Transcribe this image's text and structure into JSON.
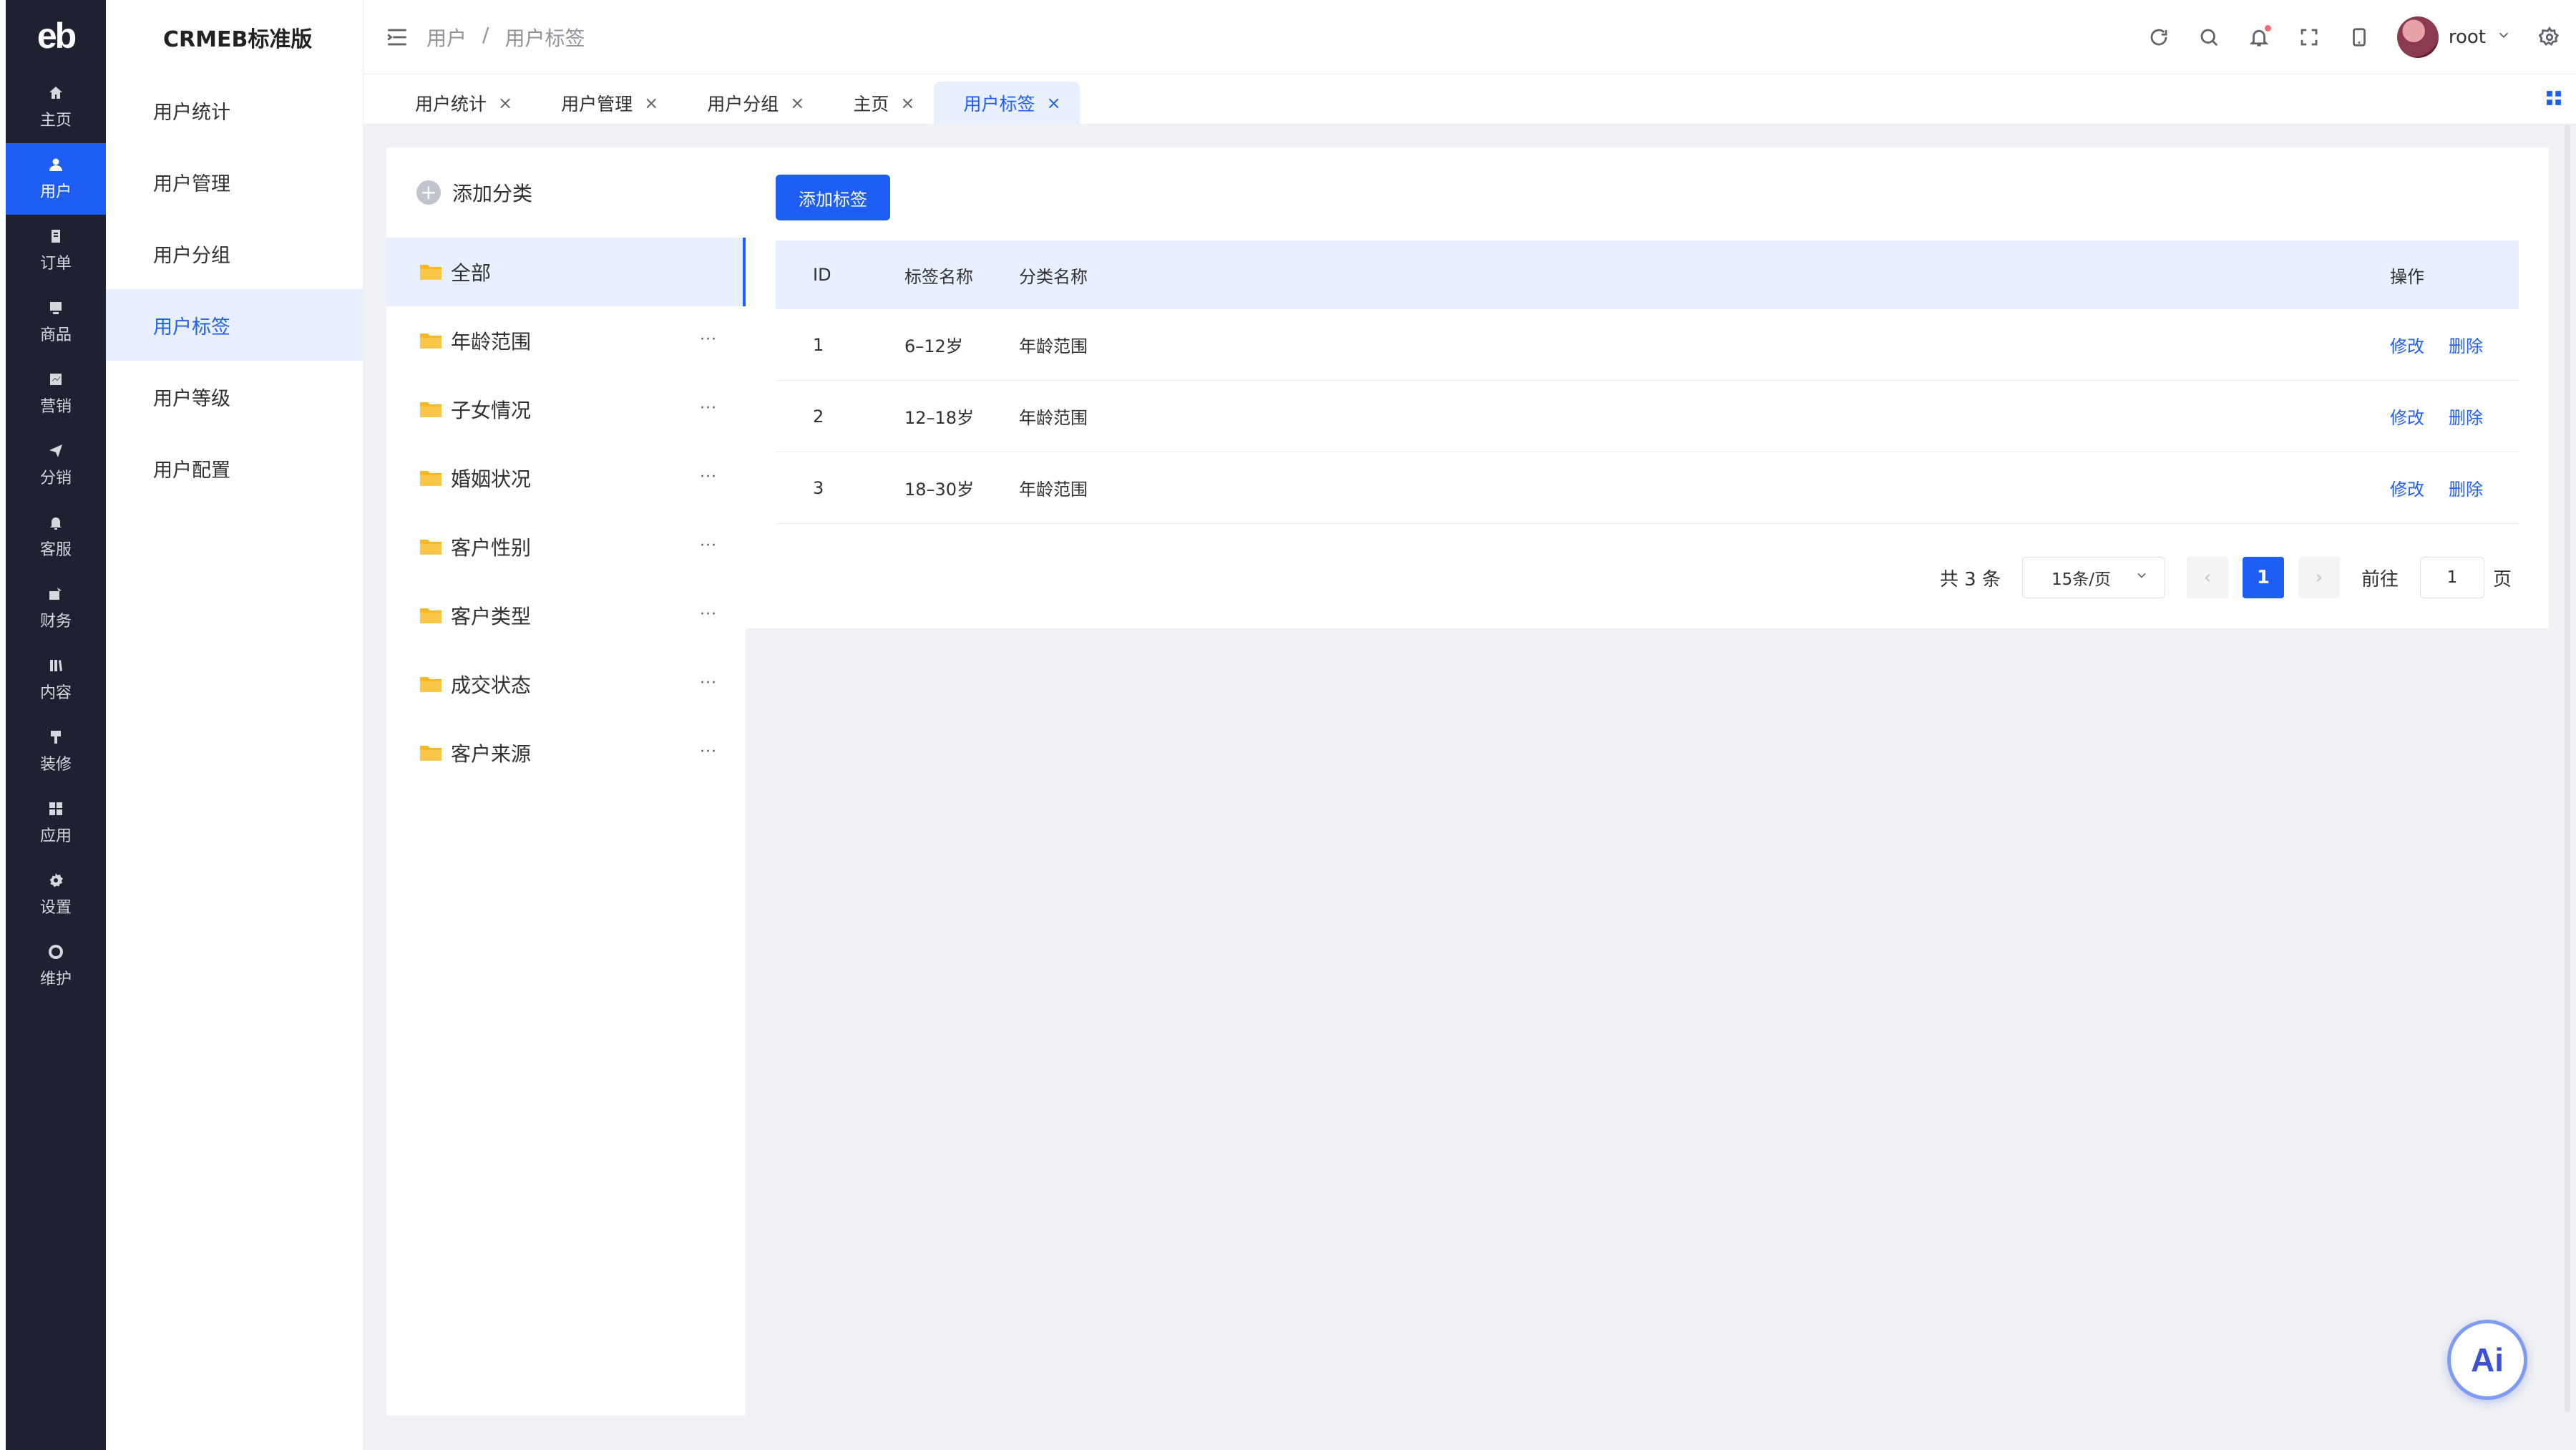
{
  "rail": {
    "logo": "eb",
    "items": [
      {
        "label": "主页",
        "icon": "home-icon"
      },
      {
        "label": "用户",
        "icon": "user-icon",
        "active": true
      },
      {
        "label": "订单",
        "icon": "order-icon"
      },
      {
        "label": "商品",
        "icon": "product-icon"
      },
      {
        "label": "营销",
        "icon": "marketing-icon"
      },
      {
        "label": "分销",
        "icon": "distribution-icon"
      },
      {
        "label": "客服",
        "icon": "bell-icon"
      },
      {
        "label": "财务",
        "icon": "finance-icon"
      },
      {
        "label": "内容",
        "icon": "content-icon"
      },
      {
        "label": "装修",
        "icon": "decorate-icon"
      },
      {
        "label": "应用",
        "icon": "apps-icon"
      },
      {
        "label": "设置",
        "icon": "gear-icon"
      },
      {
        "label": "维护",
        "icon": "maintenance-icon"
      }
    ]
  },
  "subnav": {
    "brand": "CRMEB标准版",
    "items": [
      "用户统计",
      "用户管理",
      "用户分组",
      "用户标签",
      "用户等级",
      "用户配置"
    ],
    "active_index": 3
  },
  "header": {
    "breadcrumb": [
      "用户",
      "/",
      "用户标签"
    ],
    "username": "root"
  },
  "tabs": [
    {
      "label": "用户统计",
      "close": "×"
    },
    {
      "label": "用户管理",
      "close": "×"
    },
    {
      "label": "用户分组",
      "close": "×"
    },
    {
      "label": "主页",
      "close": "×"
    },
    {
      "label": "用户标签",
      "close": "×",
      "active": true
    }
  ],
  "categories": {
    "add_label": "添加分类",
    "items": [
      "全部",
      "年龄范围",
      "子女情况",
      "婚姻状况",
      "客户性别",
      "客户类型",
      "成交状态",
      "客户来源"
    ],
    "more": "···"
  },
  "main": {
    "add_button": "添加标签",
    "columns": {
      "id": "ID",
      "name": "标签名称",
      "category": "分类名称",
      "ops": "操作"
    },
    "rows": [
      {
        "id": "1",
        "name": "6–12岁",
        "category": "年龄范围",
        "edit": "修改",
        "delete": "删除"
      },
      {
        "id": "2",
        "name": "12–18岁",
        "category": "年龄范围",
        "edit": "修改",
        "delete": "删除"
      },
      {
        "id": "3",
        "name": "18–30岁",
        "category": "年龄范围",
        "edit": "修改",
        "delete": "删除"
      }
    ],
    "pager": {
      "total": "共 3 条",
      "page_size": "15条/页",
      "prev": "‹",
      "current": "1",
      "next": "›",
      "goto_label": "前往",
      "goto_value": "1",
      "page_suffix": "页"
    }
  },
  "ai_button": "Ai",
  "colors": {
    "primary": "#1f5ef5",
    "rail_bg": "#1e2130",
    "active_bg": "#e8effe",
    "folder": "#f7b928"
  }
}
